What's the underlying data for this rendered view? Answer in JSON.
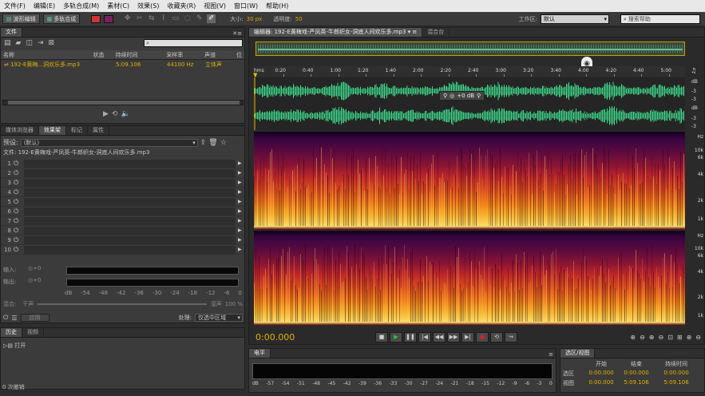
{
  "menu": [
    "文件(F)",
    "编辑(E)",
    "多轨合成(M)",
    "素材(C)",
    "效果(S)",
    "收藏夹(R)",
    "视图(V)",
    "窗口(W)",
    "帮助(H)"
  ],
  "toolbar": {
    "waveform_label": "波形编辑",
    "multitrack_label": "多轨合成",
    "size_label": "大小:",
    "size_value": "30 px",
    "opacity_label": "透明度:",
    "opacity_value": "50",
    "workspace_label": "工作区:",
    "workspace_value": "默认",
    "search_placeholder": "搜索帮助"
  },
  "files_panel": {
    "tab": "文件",
    "columns": [
      "名称",
      "状态",
      "持续时间",
      "采样率",
      "声道",
      "位"
    ],
    "file": {
      "name": "192-E黄梅...洞欢乐多.mp3",
      "duration": "5:09.106",
      "rate": "44100 Hz",
      "channels": "立体声"
    }
  },
  "effects_panel": {
    "tabs": [
      "媒体浏览器",
      "效果架",
      "标记",
      "属性"
    ],
    "preset_label": "预设:",
    "preset_value": "(默认)",
    "file_label": "文件: 192-E黄梅戏-严凤英-牛郎织女-洞底人间欢乐多.mp3",
    "slots": [
      "1",
      "2",
      "3",
      "4",
      "5",
      "6",
      "7",
      "8",
      "9",
      "10"
    ],
    "input_label": "输入:",
    "output_label": "输出:",
    "input_db": "+0",
    "output_db": "+0",
    "meter_scale": [
      "dB",
      "-54",
      "-48",
      "-42",
      "-36",
      "-30",
      "-24",
      "-18",
      "-12",
      "-6",
      "0"
    ],
    "mix_label": "混合:",
    "mix_value": "100 %",
    "dry_label": "干声",
    "wet_label": "湿声",
    "apply_label": "应用",
    "process_label": "处理:",
    "process_value": "仅选中区域"
  },
  "history_panel": {
    "tabs": [
      "历史",
      "视频"
    ],
    "item": "打开",
    "undo_count": "0 次撤销"
  },
  "editor": {
    "tab_active": "编辑器: 192-E黄梅戏-严凤英-牛郎织女-洞底人间欢乐多.mp3",
    "tab_mixer": "混合台",
    "ruler_labels": [
      "hms",
      "0:20",
      "0:40",
      "1:00",
      "1:20",
      "1:40",
      "2:00",
      "2:20",
      "2:40",
      "3:00",
      "3:20",
      "3:40",
      "4:00",
      "4:20",
      "4:40",
      "5:00"
    ],
    "hud_db": "+0 dB",
    "db_marks": [
      "dB",
      "-3",
      "-3",
      "dB",
      "-3",
      "-3"
    ],
    "hz_label": "Hz",
    "freq_labels": [
      "10k",
      "6k",
      "4k",
      "2k",
      "1k"
    ],
    "current_time": "0:00.000"
  },
  "level_panel": {
    "tab": "电平",
    "scale": [
      "dB",
      "-57",
      "-54",
      "-51",
      "-48",
      "-45",
      "-42",
      "-39",
      "-36",
      "-33",
      "-30",
      "-27",
      "-24",
      "-21",
      "-18",
      "-15",
      "-12",
      "-9",
      "-6",
      "-3",
      "0"
    ]
  },
  "selection_panel": {
    "tab": "选区/视图",
    "col_start": "开始",
    "col_end": "结束",
    "col_duration": "持续时间",
    "row_selection": "选区",
    "row_view": "视图",
    "sel_start": "0:00.000",
    "sel_end": "0:00.000",
    "sel_duration": "0:00.000",
    "view_start": "0:00.000",
    "view_end": "5:09.106",
    "view_duration": "5:09.106"
  },
  "colors": {
    "waveform": "#3fd68a",
    "accent": "#e0b000",
    "playhead": "#e8c000"
  }
}
